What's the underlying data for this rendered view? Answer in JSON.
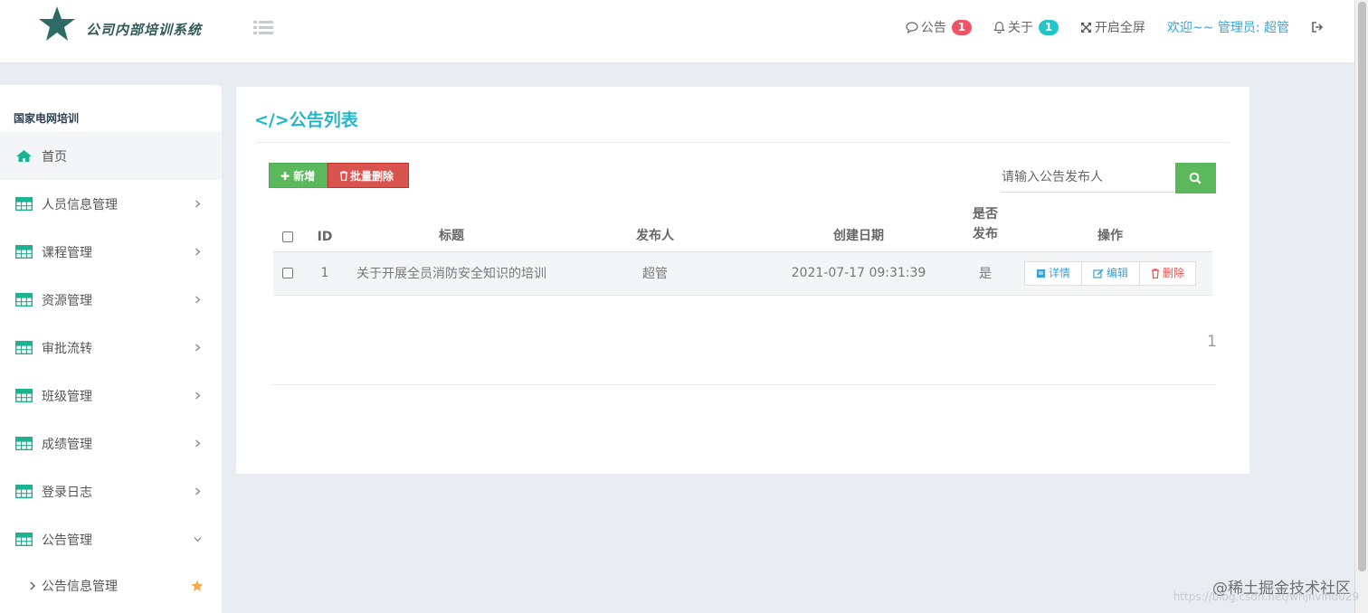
{
  "header": {
    "logo_text": "公司内部培训系统",
    "notice_label": "公告",
    "notice_count": "1",
    "about_label": "关于",
    "about_count": "1",
    "fullscreen_label": "开启全屏",
    "welcome_text": "欢迎~~ 管理员: 超管"
  },
  "sidebar": {
    "section_title": "国家电网培训",
    "home_label": "首页",
    "items": [
      {
        "label": "人员信息管理"
      },
      {
        "label": "课程管理"
      },
      {
        "label": "资源管理"
      },
      {
        "label": "审批流转"
      },
      {
        "label": "班级管理"
      },
      {
        "label": "成绩管理"
      },
      {
        "label": "登录日志"
      },
      {
        "label": "公告管理"
      }
    ],
    "sub_item_label": "公告信息管理"
  },
  "main": {
    "title": "</>公告列表",
    "add_button": "✚ 新增",
    "batch_delete_button": "批量删除",
    "search_placeholder": "请输入公告发布人",
    "table": {
      "columns": [
        "ID",
        "标题",
        "发布人",
        "创建日期",
        "是否发布",
        "操作"
      ],
      "rows": [
        {
          "id": "1",
          "title": "关于开展全员消防安全知识的培训",
          "publisher": "超管",
          "created": "2021-07-17 09:31:39",
          "published": "是"
        }
      ],
      "actions": {
        "detail": "详情",
        "edit": "编辑",
        "delete": "删除"
      }
    },
    "page_number": "1"
  },
  "watermark": {
    "brand": "@稀土掘金技术社区",
    "url": "https://blog.csdn.net/whjnvind029"
  },
  "colors": {
    "accent": "#23b7c9",
    "green": "#5cb85c",
    "red": "#d9534f",
    "badge_red": "#ed5565",
    "badge_cyan": "#23c6c8",
    "sidebar_icon": "#1ab394"
  }
}
